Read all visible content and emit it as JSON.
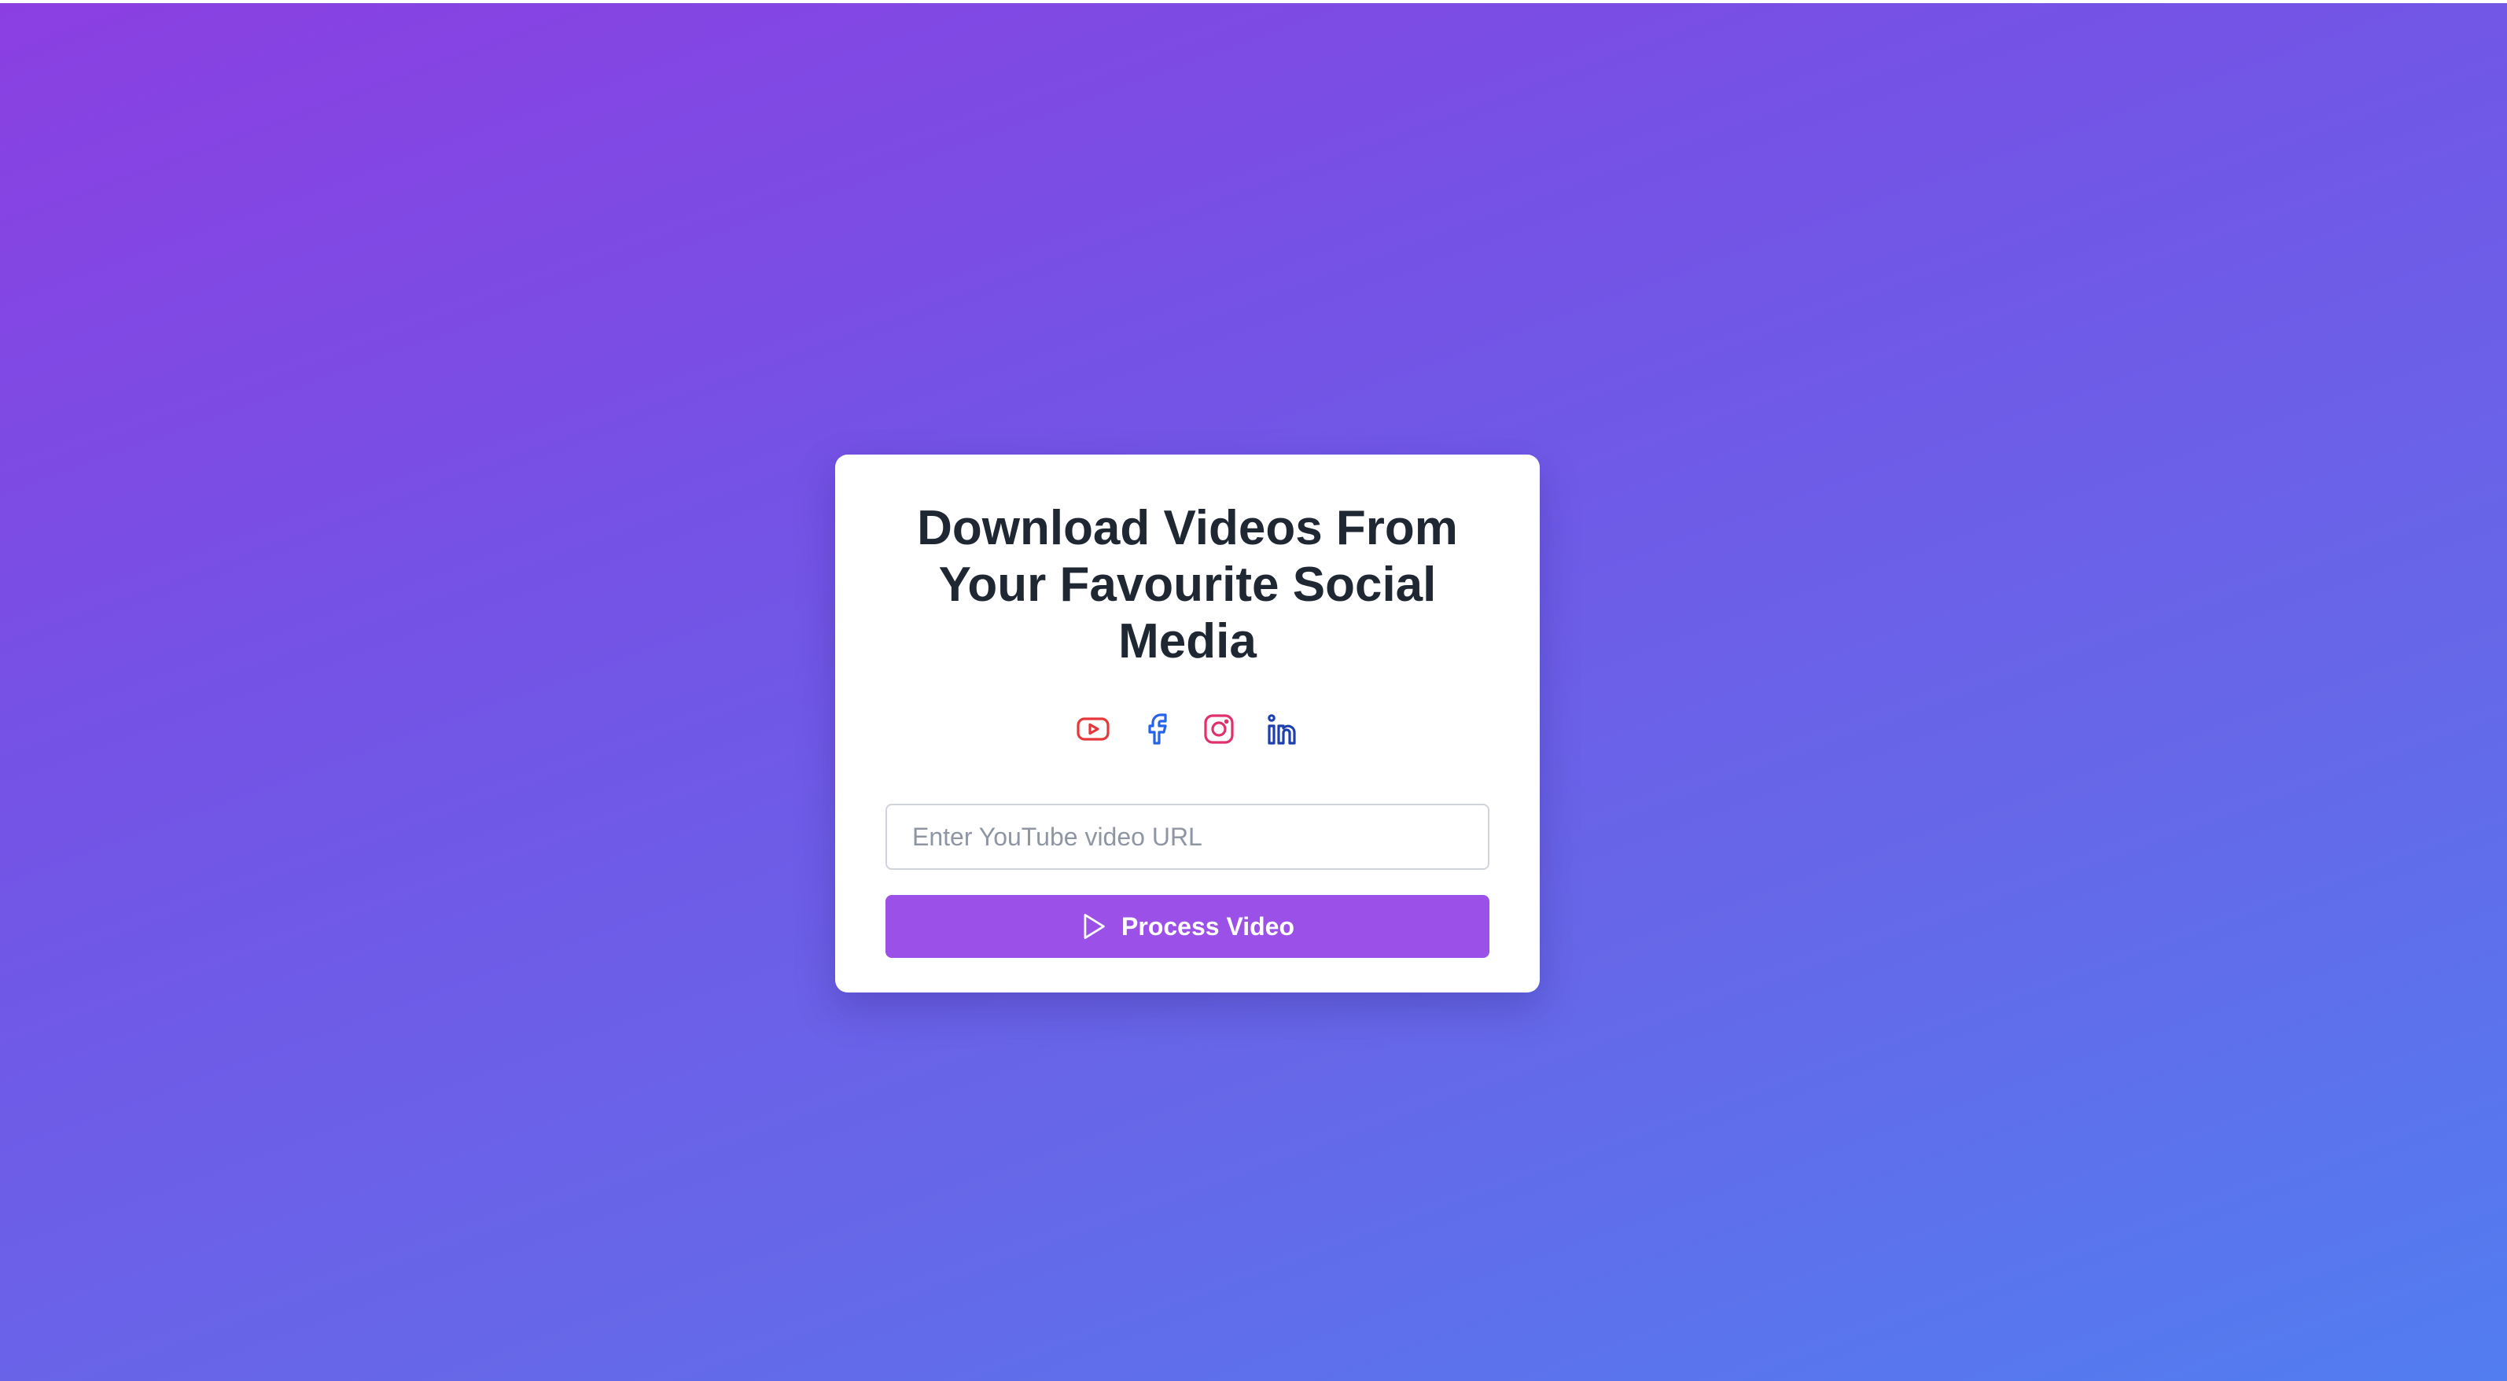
{
  "card": {
    "title": "Download Videos From Your Favourite Social Media",
    "platforms": [
      {
        "name": "youtube",
        "icon": "youtube-icon",
        "color": "#e5383b"
      },
      {
        "name": "facebook",
        "icon": "facebook-icon",
        "color": "#2563eb"
      },
      {
        "name": "instagram",
        "icon": "instagram-icon",
        "color": "#e1306c"
      },
      {
        "name": "linkedin",
        "icon": "linkedin-icon",
        "color": "#1e40af"
      }
    ],
    "url_input": {
      "value": "",
      "placeholder": "Enter YouTube video URL"
    },
    "process_button": {
      "label": "Process Video",
      "icon": "play-icon",
      "color": "#9b51e8"
    }
  },
  "colors": {
    "background_start": "#8b3fe2",
    "background_end": "#527df0",
    "card_background": "#ffffff",
    "title_text": "#1f2733"
  }
}
